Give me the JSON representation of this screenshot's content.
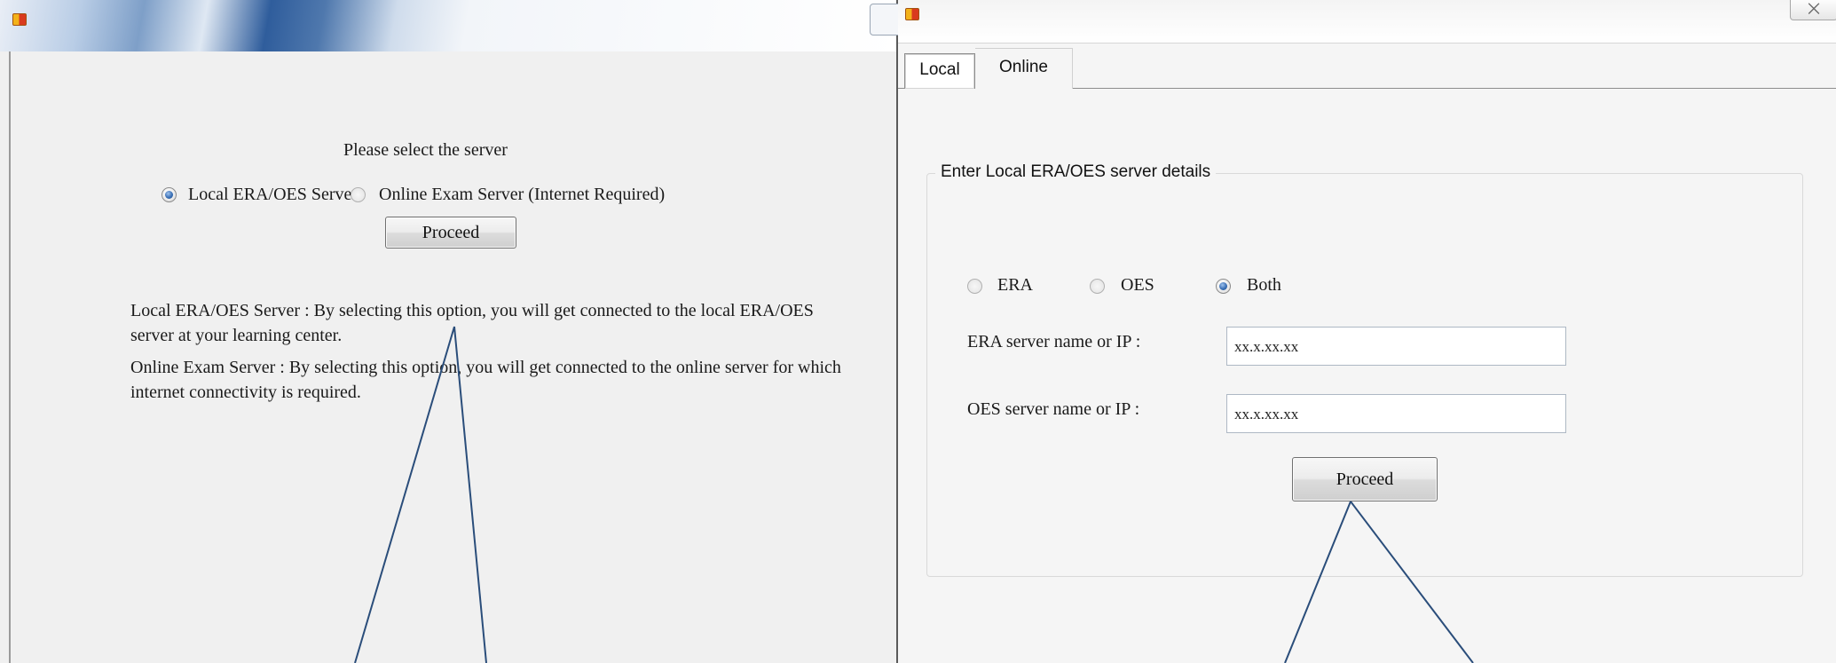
{
  "left_window": {
    "prompt": "Please select the server",
    "radio_options": [
      {
        "label": "Local ERA/OES Server",
        "checked": true
      },
      {
        "label": "Online Exam Server (Internet Required)",
        "checked": false
      }
    ],
    "proceed_label": "Proceed",
    "description_local": "Local ERA/OES Server : By selecting this option, you will get connected to the local ERA/OES server at your learning center.",
    "description_online": "Online Exam Server : By selecting this option, you will get connected to the online server for which internet connectivity is required."
  },
  "right_window": {
    "close_symbol": "⨉",
    "tabs": [
      {
        "label": "Local",
        "selected": true
      },
      {
        "label": "Online",
        "selected": false
      }
    ],
    "group_title": "Enter Local ERA/OES server details",
    "mode_options": [
      {
        "label": "ERA",
        "checked": false
      },
      {
        "label": "OES",
        "checked": false
      },
      {
        "label": "Both",
        "checked": true
      }
    ],
    "era_label": "ERA server name or IP :",
    "era_value": "xx.x.xx.xx",
    "oes_label": "OES server name or IP :",
    "oes_value": "xx.x.xx.xx",
    "proceed_label": "Proceed"
  },
  "colors": {
    "window_bg": "#f0f0f0",
    "radio_accent": "#3a6fb5",
    "callout_line": "#2a4d7a"
  }
}
